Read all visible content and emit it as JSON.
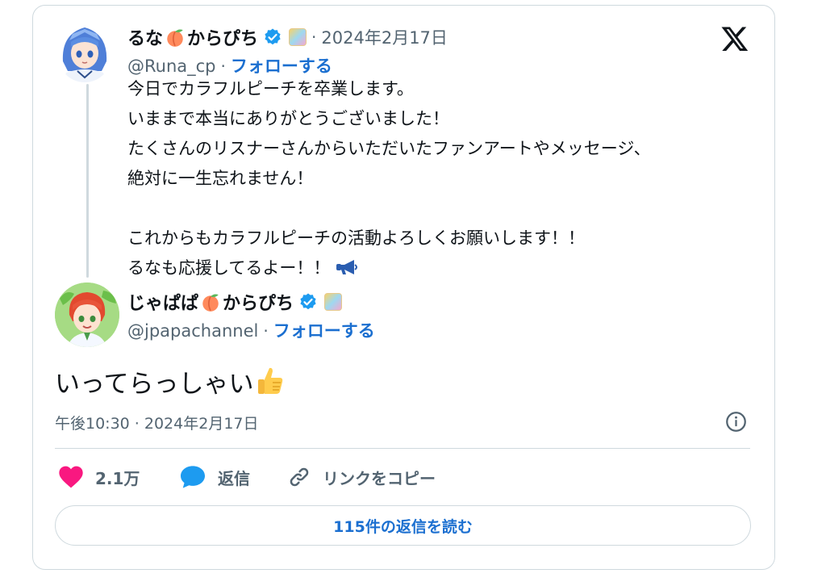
{
  "quoted": {
    "name_part1": "るな",
    "name_part2": "からぴち",
    "date": "2024年2月17日",
    "handle": "@Runa_cp",
    "follow": "フォローする",
    "text": "今日でカラフルピーチを卒業します。\nいままで本当にありがとうございました！\nたくさんのリスナーさんからいただいたファンアートやメッセージ、\n絶対に一生忘れません！\n\nこれからもカラフルピーチの活動よろしくお願いします！！\nるなも応援してるよー！！"
  },
  "reply": {
    "name_part1": "じゃぱぱ",
    "name_part2": "からぴち",
    "handle": "@jpapachannel",
    "follow": "フォローする",
    "text": "いってらっしゃい",
    "timestamp": "午後10:30 · 2024年2月17日"
  },
  "actions": {
    "like_count": "2.1万",
    "reply_label": "返信",
    "copy_label": "リンクをコピー"
  },
  "read_replies": "115件の返信を読む",
  "separator": "·",
  "colors": {
    "link_blue": "#1b6fd0",
    "verified_blue": "#1d9bf0",
    "like_pink": "#f91880",
    "muted": "#536471"
  },
  "icons": [
    "x-logo-icon",
    "peach-icon",
    "verified-badge-icon",
    "affiliate-badge-icon",
    "megaphone-icon",
    "thumbs-up-icon",
    "info-icon",
    "heart-icon",
    "reply-bubble-icon",
    "link-icon"
  ]
}
